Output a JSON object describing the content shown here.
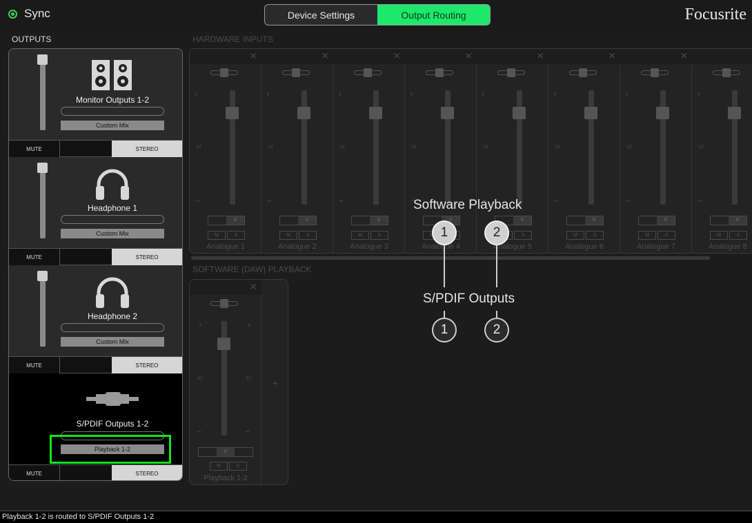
{
  "topbar": {
    "sync_label": "Sync",
    "tabs": [
      {
        "label": "Device Settings",
        "active": false
      },
      {
        "label": "Output Routing",
        "active": true
      }
    ],
    "brand": "Focusrite"
  },
  "colors": {
    "accent": "#1ee86b",
    "sync": "#39d353",
    "highlight": "#12e51e"
  },
  "outputs": {
    "title": "OUTPUTS",
    "items": [
      {
        "name": "Monitor Outputs 1-2",
        "icon": "speakers-icon",
        "mix": "Custom Mix",
        "mute": "MUTE",
        "stereo": "STEREO"
      },
      {
        "name": "Headphone 1",
        "icon": "headphones-icon",
        "mix": "Custom Mix",
        "mute": "MUTE",
        "stereo": "STEREO"
      },
      {
        "name": "Headphone 2",
        "icon": "headphones-icon",
        "mix": "Custom Mix",
        "mute": "MUTE",
        "stereo": "STEREO"
      },
      {
        "name": "S/PDIF Outputs 1-2",
        "icon": "spdif-cable-icon",
        "mix": "Playback 1-2",
        "mute": "MUTE",
        "stereo": "STEREO"
      }
    ]
  },
  "hardware_inputs": {
    "title": "HARDWARE INPUTS",
    "channels": [
      "Analogue 1",
      "Analogue 2",
      "Analogue 3",
      "Analogue 4",
      "Analogue 5",
      "Analogue 6",
      "Analogue 7",
      "Analogue 8"
    ]
  },
  "strip_common": {
    "tick_0": "0",
    "tick_12": "-12",
    "tick_inf": "-∞",
    "m": "M",
    "s": "S",
    "pan_center": "0"
  },
  "software_playback": {
    "title": "SOFTWARE (DAW) PLAYBACK",
    "channel": "Playback 1-2",
    "add": "+"
  },
  "diagram": {
    "top_label": "Software Playback",
    "bottom_label": "S/PDIF Outputs",
    "nodes_top": [
      "1",
      "2"
    ],
    "nodes_bottom": [
      "1",
      "2"
    ]
  },
  "status_bar": "Playback 1-2 is routed to S/PDIF Outputs 1-2"
}
